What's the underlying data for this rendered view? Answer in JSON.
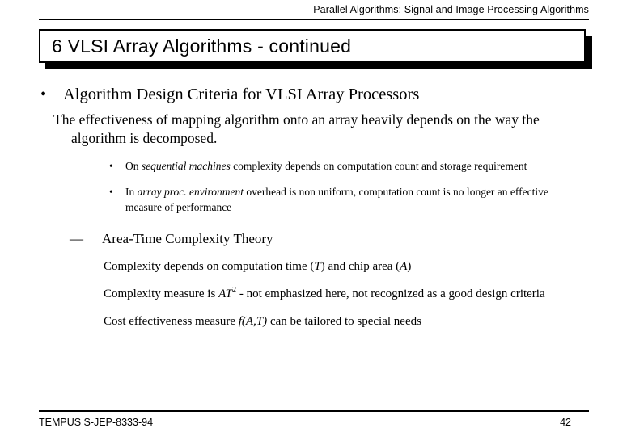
{
  "header": {
    "running_title": "Parallel Algorithms:  Signal and Image Processing Algorithms"
  },
  "title": {
    "text": "6 VLSI  Array  Algorithms - continued"
  },
  "content": {
    "bullet_marker": "•",
    "dash_marker": "—",
    "level1": "Algorithm Design Criteria for VLSI Array Processors",
    "level2": "The effectiveness of mapping algorithm onto an array heavily depends on the way the algorithm is decomposed.",
    "subbullets": [
      {
        "pre": "On ",
        "emphasis": "sequential machines",
        "post": " complexity depends on computation count and storage requirement"
      },
      {
        "pre": "In ",
        "emphasis": "array proc. environment",
        "post": " overhead is non uniform, computation count is no longer an effective measure of performance"
      }
    ],
    "section_heading": "Area-Time Complexity Theory",
    "detail_lines": {
      "line1_pre": "Complexity depends on computation time (",
      "line1_var1": "T",
      "line1_mid": ") and chip area (",
      "line1_var2": "A",
      "line1_post": ")",
      "line2_pre": "Complexity measure is ",
      "line2_var": "AT",
      "line2_sup": "2",
      "line2_post": " - not emphasized here, not recognized as a good design criteria",
      "line3_pre": "Cost effectiveness measure ",
      "line3_var": "f(A,T)",
      "line3_post": " can be tailored to special needs"
    }
  },
  "footer": {
    "project": "TEMPUS S-JEP-8333-94",
    "page_number": "42"
  }
}
